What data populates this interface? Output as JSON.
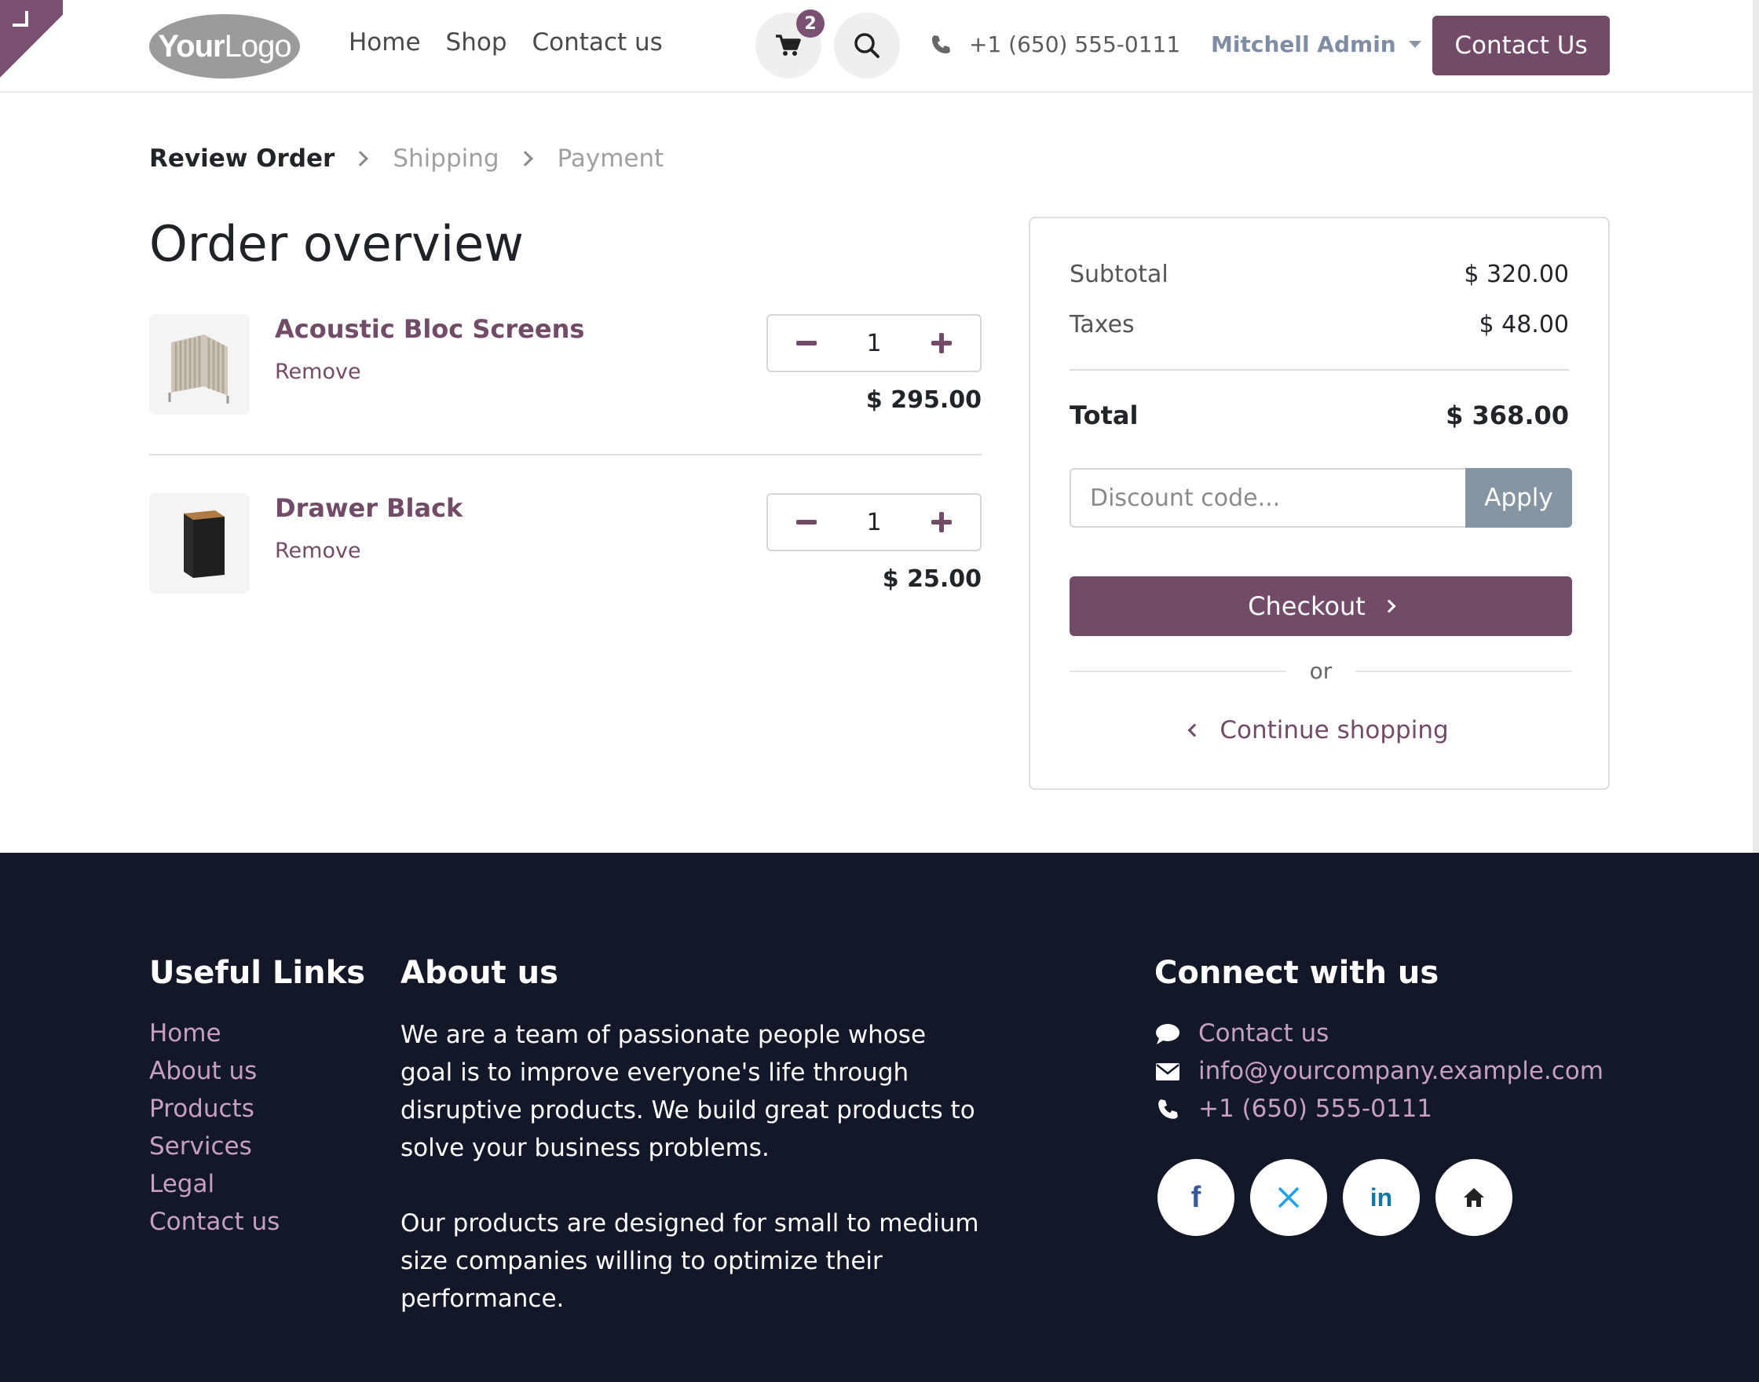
{
  "header": {
    "logo_bold": "Your",
    "logo_light": "Logo",
    "nav": [
      "Home",
      "Shop",
      "Contact us"
    ],
    "cart_count": "2",
    "phone": "+1 (650) 555-0111",
    "user": "Mitchell Admin",
    "contact_button": "Contact Us"
  },
  "checkout_steps": {
    "active": "Review Order",
    "steps": [
      "Shipping",
      "Payment"
    ]
  },
  "page_title": "Order overview",
  "products": [
    {
      "name": "Acoustic Bloc Screens",
      "remove": "Remove",
      "quantity": "1",
      "price": "$ 295.00"
    },
    {
      "name": "Drawer Black",
      "remove": "Remove",
      "quantity": "1",
      "price": "$ 25.00"
    }
  ],
  "summary": {
    "subtotal_label": "Subtotal",
    "subtotal": "$ 320.00",
    "taxes_label": "Taxes",
    "taxes": "$ 48.00",
    "total_label": "Total",
    "total": "$ 368.00",
    "discount_placeholder": "Discount code...",
    "apply_label": "Apply",
    "checkout_label": "Checkout",
    "or_label": "or",
    "continue_label": "Continue shopping"
  },
  "footer": {
    "useful_links_title": "Useful Links",
    "useful_links": [
      "Home",
      "About us",
      "Products",
      "Services",
      "Legal",
      "Contact us"
    ],
    "about_title": "About us",
    "about_p1": "We are a team of passionate people whose goal is to improve everyone's life through disruptive products. We build great products to solve your business problems.",
    "about_p2": "Our products are designed for small to medium size companies willing to optimize their performance.",
    "connect_title": "Connect with us",
    "connect_contact": "Contact us",
    "connect_email": "info@yourcompany.example.com",
    "connect_phone": "+1 (650) 555-0111",
    "socials": [
      "facebook-icon",
      "x-twitter-icon",
      "linkedin-icon",
      "home-icon"
    ]
  },
  "colors": {
    "brand": "#714b67",
    "footer_bg": "#121828",
    "footer_link": "#c89fc0",
    "apply_bg": "#8595a2"
  }
}
